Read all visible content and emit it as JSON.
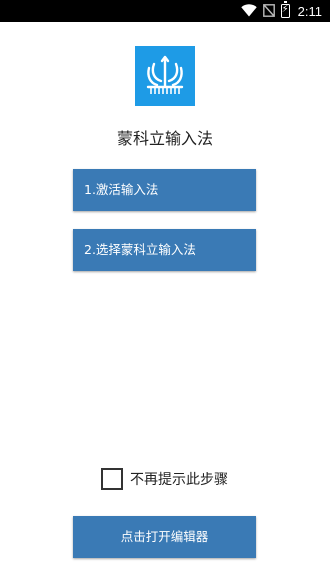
{
  "status_bar": {
    "time": "2:11",
    "icons": [
      "wifi-icon",
      "no-signal-icon",
      "battery-charging-icon"
    ],
    "battery_symbol": "⚡"
  },
  "app": {
    "logo_icon": "mongolian-trident-logo",
    "title": "蒙科立输入法"
  },
  "steps": [
    {
      "label": "1.激活输入法"
    },
    {
      "label": "2.选择蒙科立输入法"
    }
  ],
  "dont_show_again": {
    "label": "不再提示此步骤",
    "checked": false
  },
  "open_editor_button": {
    "label": "点击打开编辑器"
  },
  "colors": {
    "status_bar": "#000000",
    "background": "#ffffff",
    "logo_background": "#1e9be6",
    "button_background": "#3a7ab5",
    "button_text": "#ffffff"
  }
}
